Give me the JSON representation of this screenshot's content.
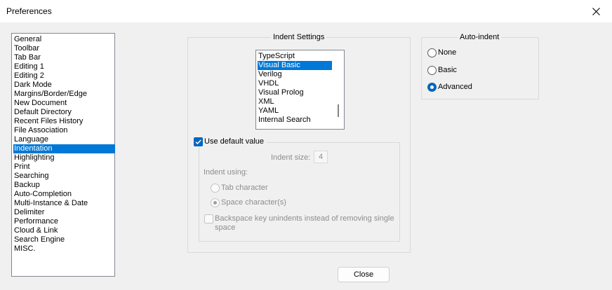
{
  "window": {
    "title": "Preferences"
  },
  "categories": {
    "items": [
      "General",
      "Toolbar",
      "Tab Bar",
      "Editing 1",
      "Editing 2",
      "Dark Mode",
      "Margins/Border/Edge",
      "New Document",
      "Default Directory",
      "Recent Files History",
      "File Association",
      "Language",
      "Indentation",
      "Highlighting",
      "Print",
      "Searching",
      "Backup",
      "Auto-Completion",
      "Multi-Instance & Date",
      "Delimiter",
      "Performance",
      "Cloud & Link",
      "Search Engine",
      "MISC."
    ],
    "selected": "Indentation"
  },
  "indent_settings": {
    "title": "Indent Settings",
    "languages": [
      "TypeScript",
      "Visual Basic",
      "Verilog",
      "VHDL",
      "Visual Prolog",
      "XML",
      "YAML",
      "Internal Search"
    ],
    "selected_language": "Visual Basic",
    "use_default_label": "Use default value",
    "use_default_checked": true,
    "indent_size_label": "Indent size:",
    "indent_size_value": "4",
    "indent_using_label": "Indent using:",
    "tab_char_label": "Tab character",
    "space_char_label": "Space character(s)",
    "backspace_label_line1": "Backspace key unindents instead of removing single",
    "backspace_label_line2": "space"
  },
  "auto_indent": {
    "title": "Auto-indent",
    "options": [
      "None",
      "Basic",
      "Advanced"
    ],
    "selected": "Advanced"
  },
  "buttons": {
    "close": "Close"
  },
  "colors": {
    "selection": "#0078d7",
    "accent": "#0067c0"
  }
}
